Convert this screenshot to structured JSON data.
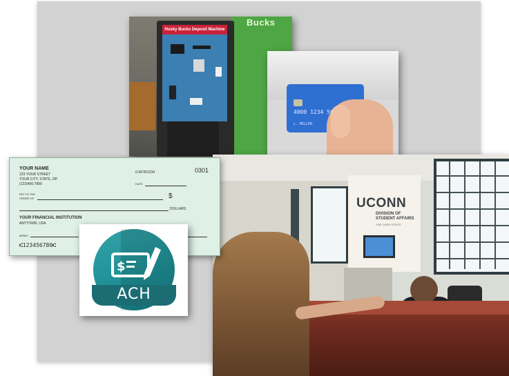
{
  "kiosk": {
    "sign_text": "Bucks",
    "panel_header": "Husky Bucks Deposit Machine"
  },
  "credit_card": {
    "number": "4000 1234 5678",
    "holder": "L. MILLER"
  },
  "cheque": {
    "payer_name": "YOUR NAME",
    "address_line1": "123 YOUR STREET",
    "address_line2": "YOUR CITY, STATE, ZIP",
    "phone": "(123)456-7890",
    "routing_ref": "0-5678/1234",
    "check_number": "0301",
    "date_label": "DATE",
    "pay_to_label": "PAY TO THE",
    "order_of_label": "ORDER OF",
    "dollar_sign": "$",
    "dollars_label": "DOLLARS",
    "bank_name": "YOUR FINANCIAL INSTITUTION",
    "bank_city": "ANYTOWN, USA",
    "memo_label": "MEMO",
    "micr": "⑆123456780⑆"
  },
  "ach_logo": {
    "label": "ACH"
  },
  "office": {
    "sign_title": "UCONN",
    "sign_line1": "DIVISION OF",
    "sign_line2": "STUDENT AFFAIRS",
    "sign_line3": "ONE CARD OFFICE"
  }
}
